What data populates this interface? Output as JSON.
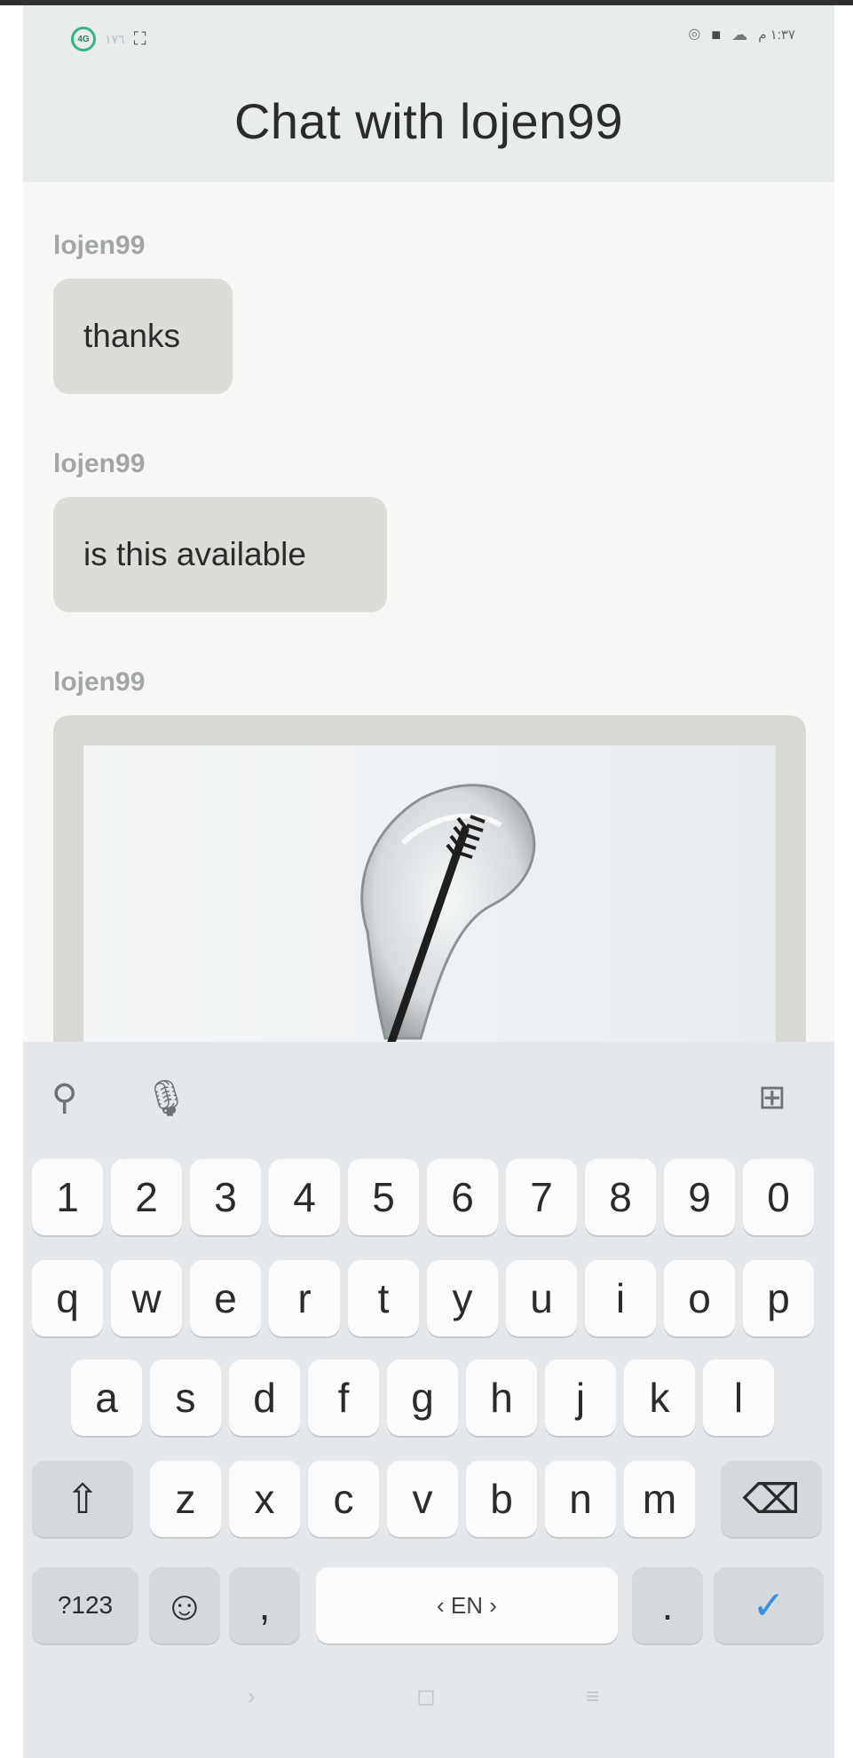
{
  "status_bar": {
    "left_badge": "4G",
    "left_text": "١٧٦",
    "time": "١:٣٧ م"
  },
  "header": {
    "title": "Chat with lojen99"
  },
  "messages": [
    {
      "author": "lojen99",
      "text": "thanks"
    },
    {
      "author": "lojen99",
      "text": "is this available"
    },
    {
      "author": "lojen99",
      "type": "image",
      "alt": "clear gel with mascara brush"
    }
  ],
  "keyboard": {
    "toolbar_icons": [
      "search-icon",
      "mic-icon",
      "grid-icon"
    ],
    "numbers": [
      "1",
      "2",
      "3",
      "4",
      "5",
      "6",
      "7",
      "8",
      "9",
      "0"
    ],
    "row1": [
      "q",
      "w",
      "e",
      "r",
      "t",
      "y",
      "u",
      "i",
      "o",
      "p"
    ],
    "row2": [
      "a",
      "s",
      "d",
      "f",
      "g",
      "h",
      "j",
      "k",
      "l"
    ],
    "row3": [
      "z",
      "x",
      "c",
      "v",
      "b",
      "n",
      "m"
    ],
    "shift_symbol": "⇧",
    "backspace_symbol": "⌫",
    "symbols_label": "?123",
    "emoji_symbol": "☺",
    "comma_label": ",",
    "space_label": "‹ EN ›",
    "period_label": ".",
    "enter_symbol": "✓",
    "accent_color": "#3b8fe0"
  },
  "navbar": {
    "back": "›",
    "home": "◻",
    "recents": "≡"
  }
}
